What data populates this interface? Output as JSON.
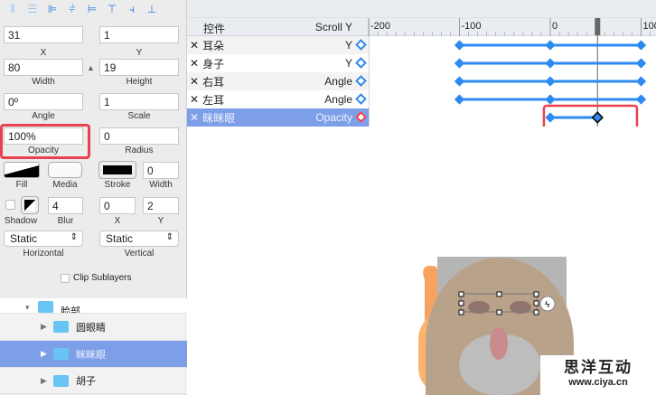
{
  "toolbar": {
    "icons": [
      "distribute-vertical-icon",
      "distribute-horizontal-icon",
      "align-left-icon",
      "align-center-icon",
      "align-right-icon",
      "align-top-icon",
      "align-middle-icon",
      "align-bottom-icon"
    ]
  },
  "inspector": {
    "x": "31",
    "x_label": "X",
    "y": "1",
    "y_label": "Y",
    "width": "80",
    "width_label": "Width",
    "height": "19",
    "height_label": "Height",
    "angle": "0º",
    "angle_label": "Angle",
    "scale": "1",
    "scale_label": "Scale",
    "opacity": "100%",
    "opacity_label": "Opacity",
    "radius": "0",
    "radius_label": "Radius",
    "fill_label": "Fill",
    "media_label": "Media",
    "stroke_label": "Stroke",
    "stroke_width": "0",
    "stroke_width_label": "Width",
    "shadow_label": "Shadow",
    "blur": "4",
    "blur_label": "Blur",
    "shadow_x": "0",
    "shadow_x_label": "X",
    "shadow_y": "2",
    "shadow_y_label": "Y",
    "horizontal": "Static",
    "horizontal_label": "Horizontal",
    "vertical": "Static",
    "vertical_label": "Vertical",
    "clip_label": "Clip Sublayers"
  },
  "layers": [
    {
      "name": "脸部",
      "selected": false
    },
    {
      "name": "圆眼睛",
      "selected": false
    },
    {
      "name": "眯眯眼",
      "selected": true
    },
    {
      "name": "胡子",
      "selected": false
    }
  ],
  "timeline": {
    "col_name": "控件",
    "col_prop": "Scroll Y",
    "ticks": [
      "-200",
      "-100",
      "0",
      "100"
    ],
    "playhead": 52,
    "rows": [
      {
        "name": "耳朵",
        "prop": "Y",
        "keys": [
          -100,
          0,
          100
        ]
      },
      {
        "name": "身子",
        "prop": "Y",
        "keys": [
          -100,
          0,
          100
        ]
      },
      {
        "name": "右耳",
        "prop": "Angle",
        "keys": [
          -100,
          0,
          100
        ]
      },
      {
        "name": "左耳",
        "prop": "Angle",
        "keys": [
          -100,
          0,
          100
        ]
      },
      {
        "name": "眯眯眼",
        "prop": "Opacity",
        "keys": [
          0,
          52
        ],
        "selected": true
      }
    ]
  },
  "watermark": {
    "title": "思洋互动",
    "url": "www.ciya.cn"
  },
  "colors": {
    "accent": "#2d8af0",
    "highlight": "#e9414f",
    "selection": "#7d9fe8"
  }
}
